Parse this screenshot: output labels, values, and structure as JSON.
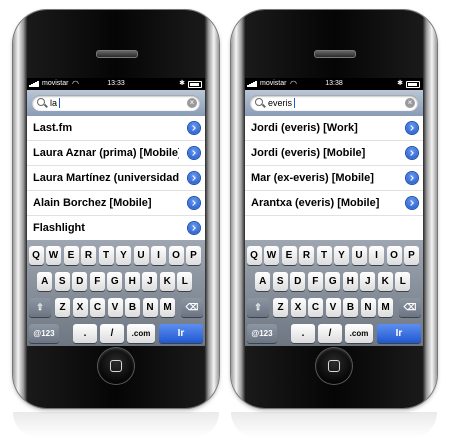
{
  "phones": [
    {
      "status": {
        "carrier": "movistar",
        "time": "13:33"
      },
      "search": {
        "query": "la"
      },
      "results": [
        {
          "label": "Last.fm"
        },
        {
          "label": "Laura Aznar (prima) [Mobile]"
        },
        {
          "label": "Laura Martínez (universidad)"
        },
        {
          "label": "Alain Borchez [Mobile]"
        },
        {
          "label": "Flashlight"
        }
      ]
    },
    {
      "status": {
        "carrier": "movistar",
        "time": "13:38"
      },
      "search": {
        "query": "everis"
      },
      "results": [
        {
          "label": "Jordi (everis) [Work]"
        },
        {
          "label": "Jordi (everis) [Mobile]"
        },
        {
          "label": "Mar (ex-everis) [Mobile]"
        },
        {
          "label": "Arantxa (everis) [Mobile]"
        }
      ]
    }
  ],
  "keyboard": {
    "row1": [
      "Q",
      "W",
      "E",
      "R",
      "T",
      "Y",
      "U",
      "I",
      "O",
      "P"
    ],
    "row2": [
      "A",
      "S",
      "D",
      "F",
      "G",
      "H",
      "J",
      "K",
      "L"
    ],
    "row3": [
      "Z",
      "X",
      "C",
      "V",
      "B",
      "N",
      "M"
    ],
    "numbers_key": "@123",
    "dot_key": ".",
    "slash_key": "/",
    "dotcom_key": ".com",
    "go_key": "Ir"
  },
  "icons": {
    "shift": "shift-icon",
    "delete": "delete-icon",
    "disclosure": "disclosure-icon",
    "magnifier": "magnifier-icon",
    "clear": "clear-icon"
  },
  "colors": {
    "search_bar": "#9aabc2",
    "accent": "#2058d0"
  }
}
